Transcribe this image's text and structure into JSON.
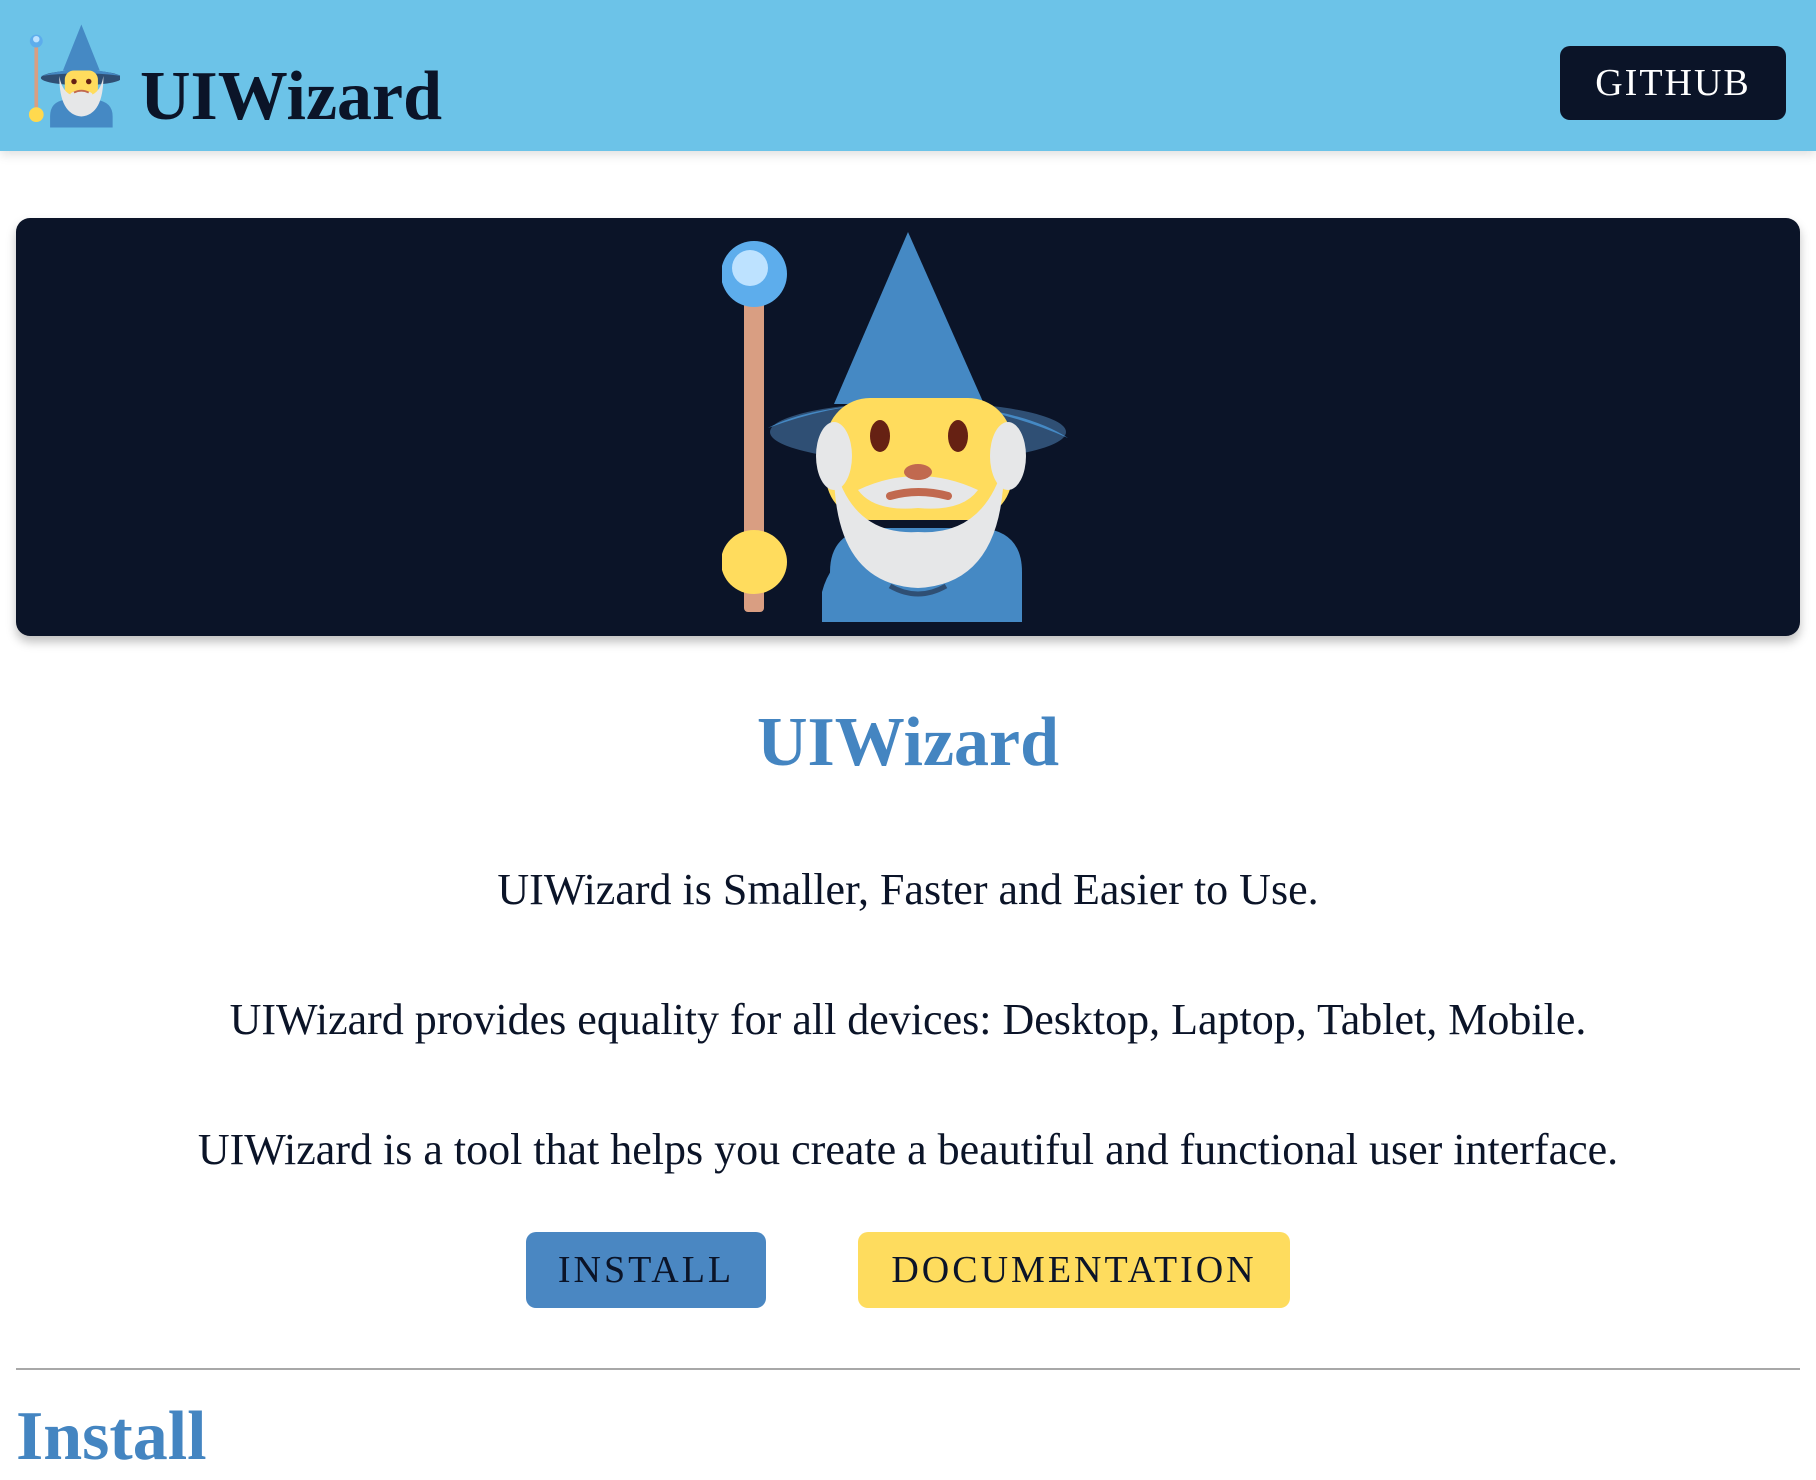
{
  "header": {
    "logo_icon": "wizard-icon",
    "title": "UIWizard",
    "github_label": "GITHUB"
  },
  "hero": {
    "image_icon": "wizard-icon",
    "title": "UIWizard",
    "taglines": [
      "UIWizard is Smaller, Faster and Easier to Use.",
      "UIWizard provides equality for all devices: Desktop, Laptop, Tablet, Mobile.",
      "UIWizard is a tool that helps you create a beautiful and functional user interface."
    ],
    "install_label": "INSTALL",
    "docs_label": "DOCUMENTATION"
  },
  "section": {
    "heading": "Install"
  },
  "colors": {
    "header_bg": "#6cc3e8",
    "dark": "#0b1428",
    "accent_blue": "#4485c1",
    "accent_yellow": "#fedc5e"
  }
}
